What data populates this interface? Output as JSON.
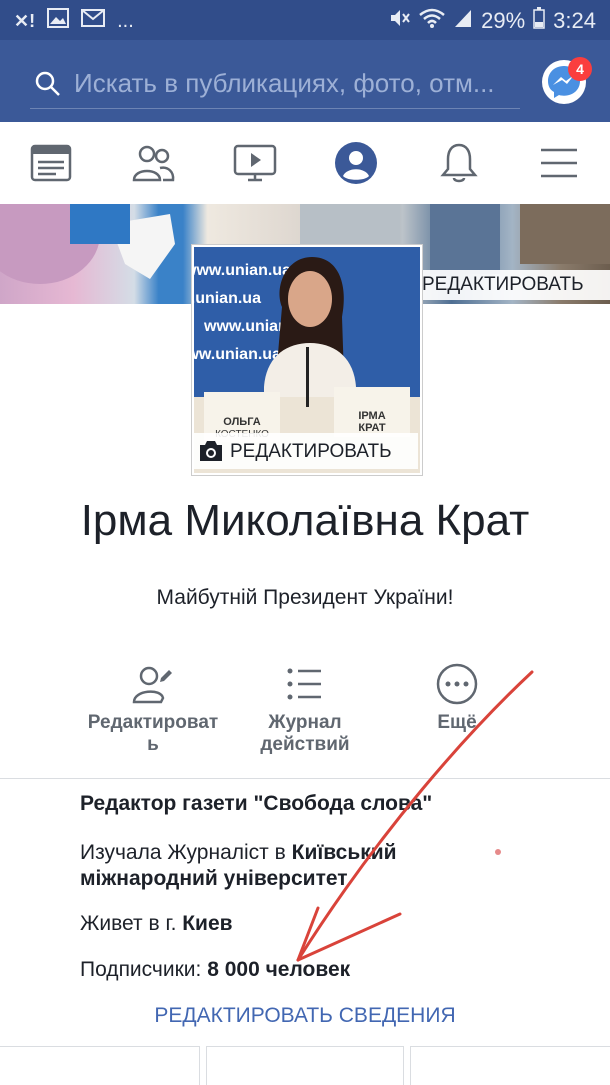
{
  "status_bar": {
    "battery": "29%",
    "time": "3:24",
    "more": "..."
  },
  "search": {
    "placeholder": "Искать в публикациях, фото, отм...",
    "messenger_badge": "4"
  },
  "cover": {
    "edit_label": "РЕДАКТИРОВАТЬ"
  },
  "avatar": {
    "edit_label": "РЕДАКТИРОВАТЬ",
    "sign_left_1": "ОЛЬГА",
    "sign_left_2": "КОСТЕНКО",
    "sign_right_1": "ІРМА",
    "sign_right_2": "КРАТ",
    "banner_text": "www.unian.ua"
  },
  "profile": {
    "name": "Ірма Миколаївна Крат",
    "bio": "Майбутній Президент України!"
  },
  "actions": [
    {
      "line1": "Редактироват",
      "line2": "ь"
    },
    {
      "line1": "Журнал",
      "line2": "действий"
    },
    {
      "line1": "Ещё",
      "line2": ""
    }
  ],
  "intro": {
    "job": "Редактор газети \"Свобода слова\"",
    "study_prefix": "Изучала Журналіст в ",
    "study_school_1": "Київський",
    "study_school_2": "міжнародний університет",
    "lives_prefix": "Живет в г. ",
    "lives_city": "Киев",
    "followers_prefix": "Подписчики: ",
    "followers_count": "8 000 человек",
    "edit_details": "РЕДАКТИРОВАТЬ СВЕДЕНИЯ"
  },
  "colors": {
    "brand": "#3b5998",
    "status_bar": "#314d8a",
    "link": "#4267b2",
    "badge": "#fa3e3e",
    "annotation_arrow": "#d9433a"
  }
}
